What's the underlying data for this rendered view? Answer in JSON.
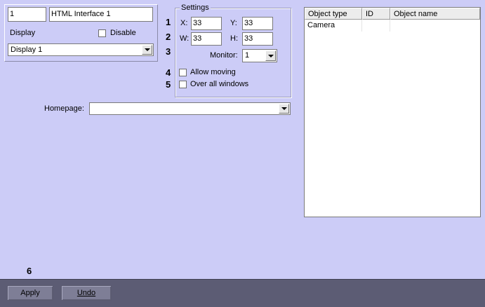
{
  "header": {
    "id_value": "1",
    "name_value": "HTML Interface 1",
    "display_label": "Display",
    "disable_label": "Disable",
    "display_select_value": "Display 1"
  },
  "settings": {
    "title": "Settings",
    "x_label": "X:",
    "x_value": "33",
    "y_label": "Y:",
    "y_value": "33",
    "w_label": "W:",
    "w_value": "33",
    "h_label": "H:",
    "h_value": "33",
    "monitor_label": "Monitor:",
    "monitor_value": "1",
    "allow_moving_label": "Allow moving",
    "over_all_windows_label": "Over all windows"
  },
  "markers": [
    "1",
    "2",
    "3",
    "4",
    "5",
    "6"
  ],
  "homepage": {
    "label": "Homepage:",
    "value": ""
  },
  "objects_table": {
    "columns": [
      "Object type",
      "ID",
      "Object name"
    ],
    "rows": [
      [
        "Camera",
        "",
        ""
      ]
    ]
  },
  "footer": {
    "apply_label": "Apply",
    "undo_label": "Undo"
  },
  "colors": {
    "background": "#ccccf7",
    "footer_bar": "#5c5c74",
    "button": "#7e7e96"
  }
}
